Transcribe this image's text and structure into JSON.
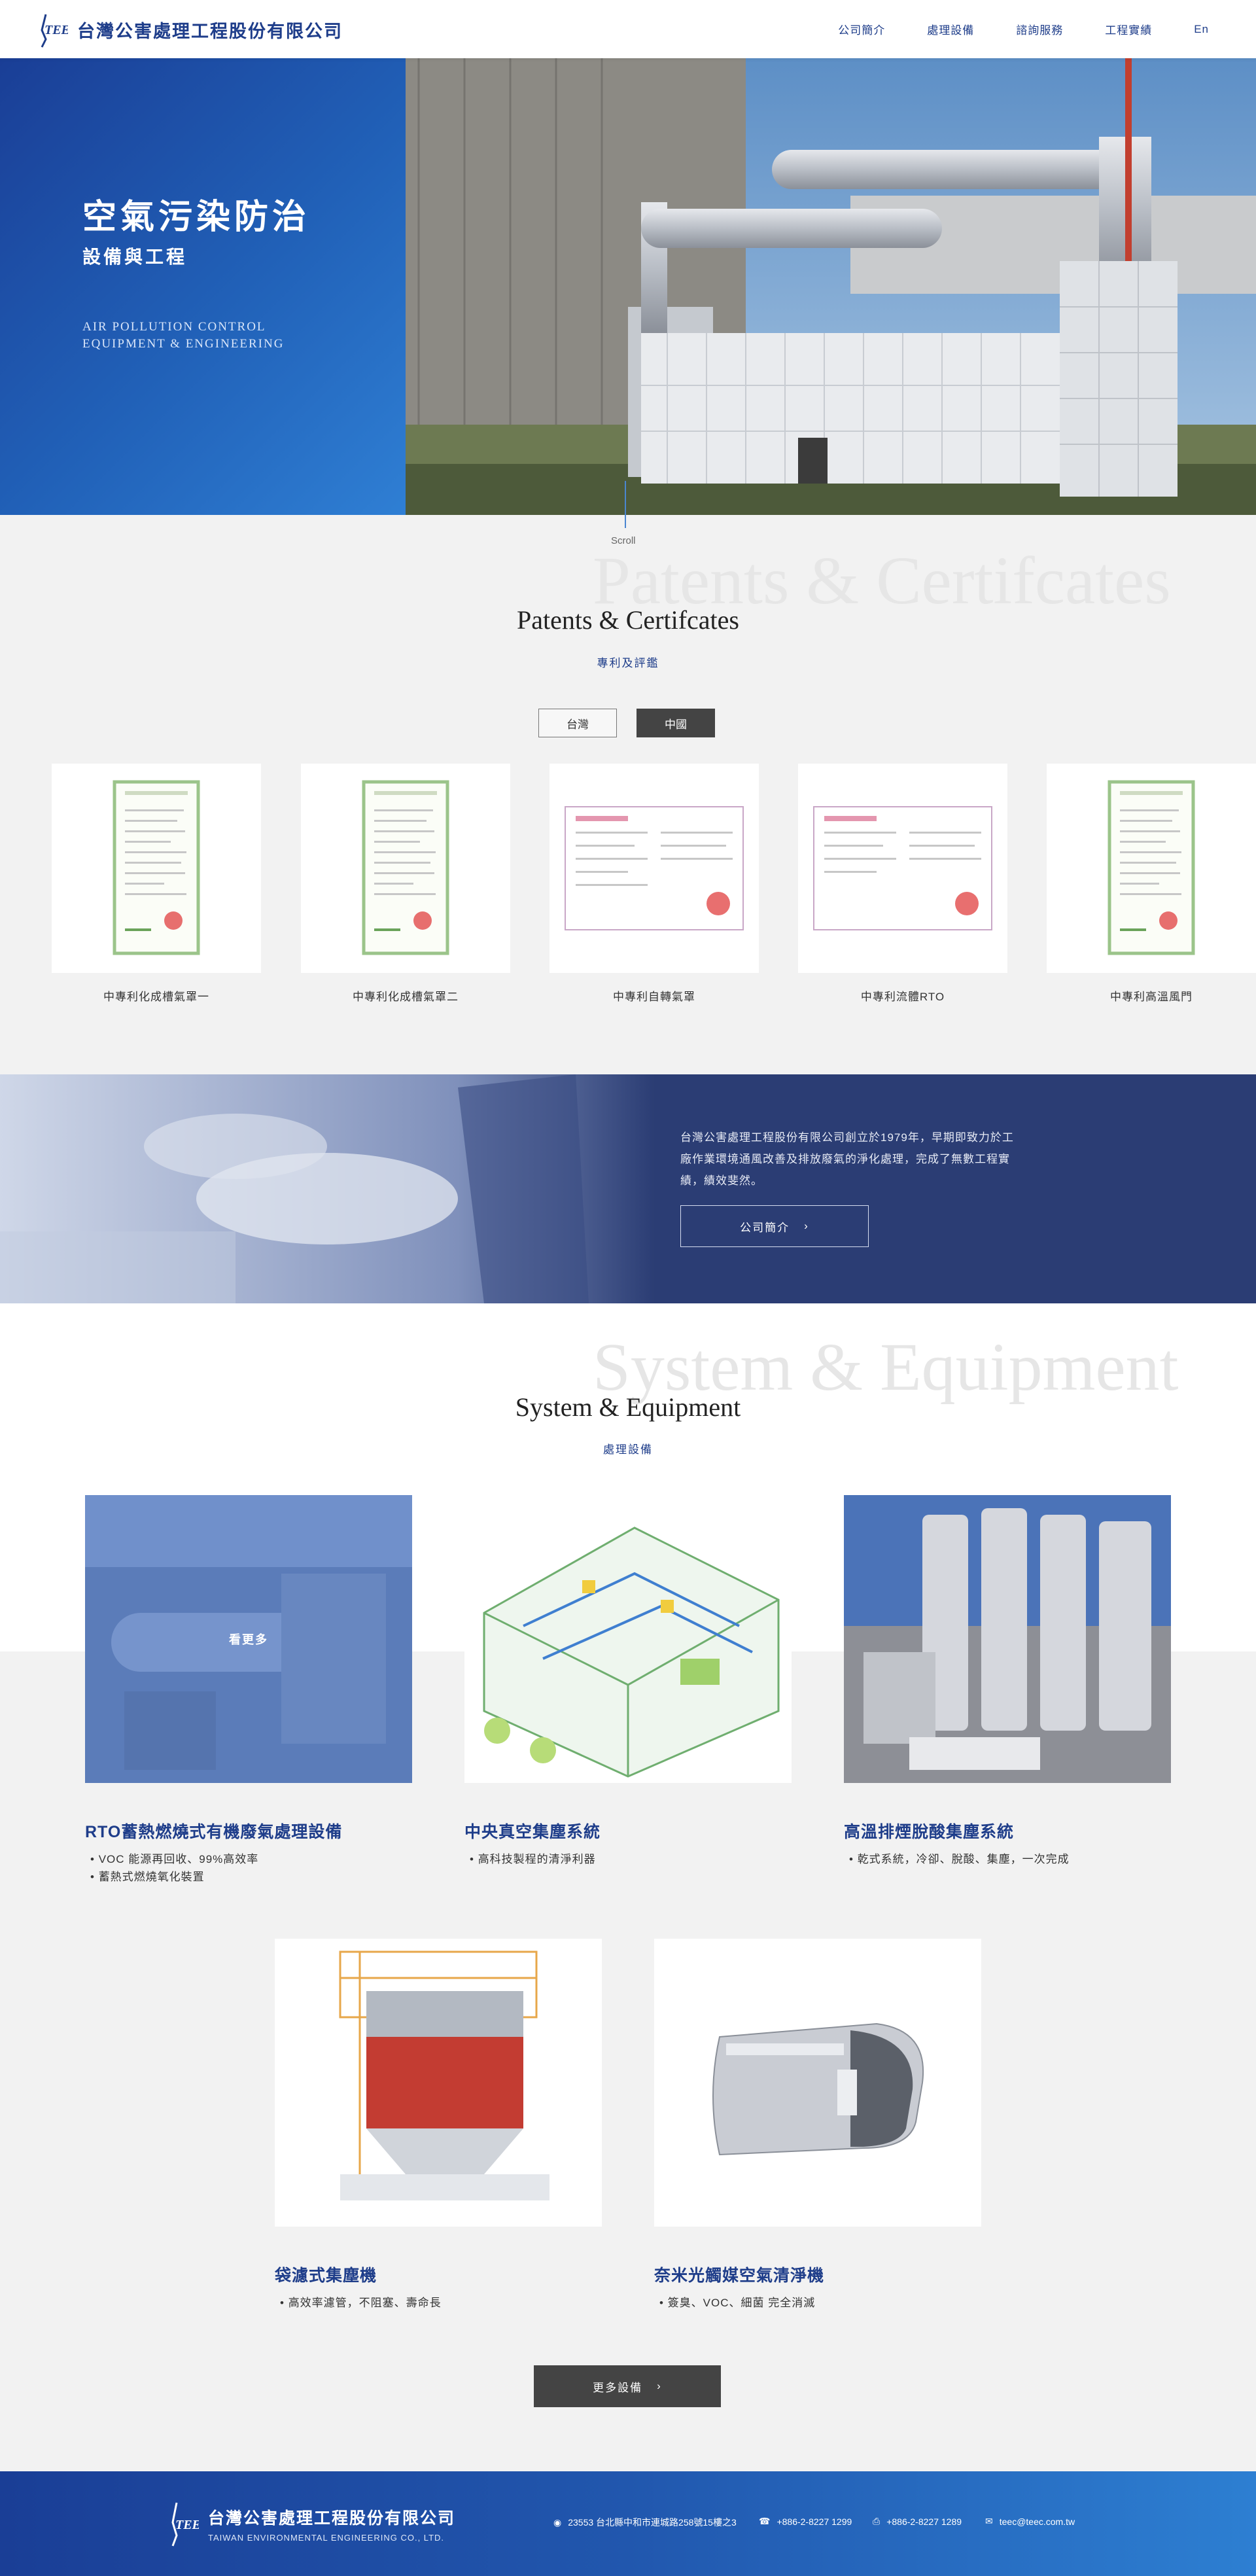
{
  "header": {
    "logo_text": "台灣公害處理工程股份有限公司",
    "nav": [
      "公司簡介",
      "處理設備",
      "諮詢服務",
      "工程實績",
      "En"
    ]
  },
  "hero": {
    "title": "空氣污染防治",
    "subtitle": "設備與工程",
    "english": "AIR POLLUTION CONTROL EQUIPMENT & ENGINEERING",
    "scroll": "Scroll"
  },
  "patents": {
    "ghost": "Patents & Certifcates",
    "title": "Patents & Certifcates",
    "subtitle": "專利及評鑑",
    "tabs": [
      "台灣",
      "中國"
    ],
    "active_tab": "中國",
    "items": [
      "中專利化成槽氣罩一",
      "中專利化成槽氣罩二",
      "中專利自轉氣罩",
      "中專利流體RTO",
      "中專利高溫風門"
    ]
  },
  "about": {
    "text": "台灣公害處理工程股份有限公司創立於1979年，早期即致力於工廠作業環境通風改善及排放廢氣的淨化處理，完成了無數工程實績，績效斐然。",
    "button": "公司簡介"
  },
  "equipment": {
    "ghost": "System & Equipment",
    "title": "System & Equipment",
    "subtitle": "處理設備",
    "overlay": "看更多",
    "items": [
      {
        "title": "RTO蓄熱燃燒式有機廢氣處理設備",
        "points": [
          "VOC 能源再回收、99%高效率",
          "蓄熱式燃燒氧化裝置"
        ]
      },
      {
        "title": "中央真空集塵系統",
        "points": [
          "高科技製程的清淨利器"
        ]
      },
      {
        "title": "高溫排煙脫酸集塵系統",
        "points": [
          "乾式系統，冷卻、脫酸、集塵，一次完成"
        ]
      },
      {
        "title": "袋濾式集塵機",
        "points": [
          "高效率濾管，不阻塞、壽命長"
        ]
      },
      {
        "title": "奈米光觸媒空氣清淨機",
        "points": [
          "簽臭、VOC、細菌 完全消滅"
        ]
      }
    ],
    "more_button": "更多設備"
  },
  "footer": {
    "name": "台灣公害處理工程股份有限公司",
    "english": "TAIWAN ENVIRONMENTAL ENGINEERING CO., LTD.",
    "address": "23553 台北縣中和市連城路258號15樓之3",
    "phone": "+886-2-8227 1299",
    "fax": "+886-2-8227 1289",
    "email": "teec@teec.com.tw"
  },
  "colors": {
    "brand": "#1e3d8a",
    "hero_blue": "#2161b8",
    "about_band": "#2b3d74",
    "dark_button": "#444444"
  }
}
